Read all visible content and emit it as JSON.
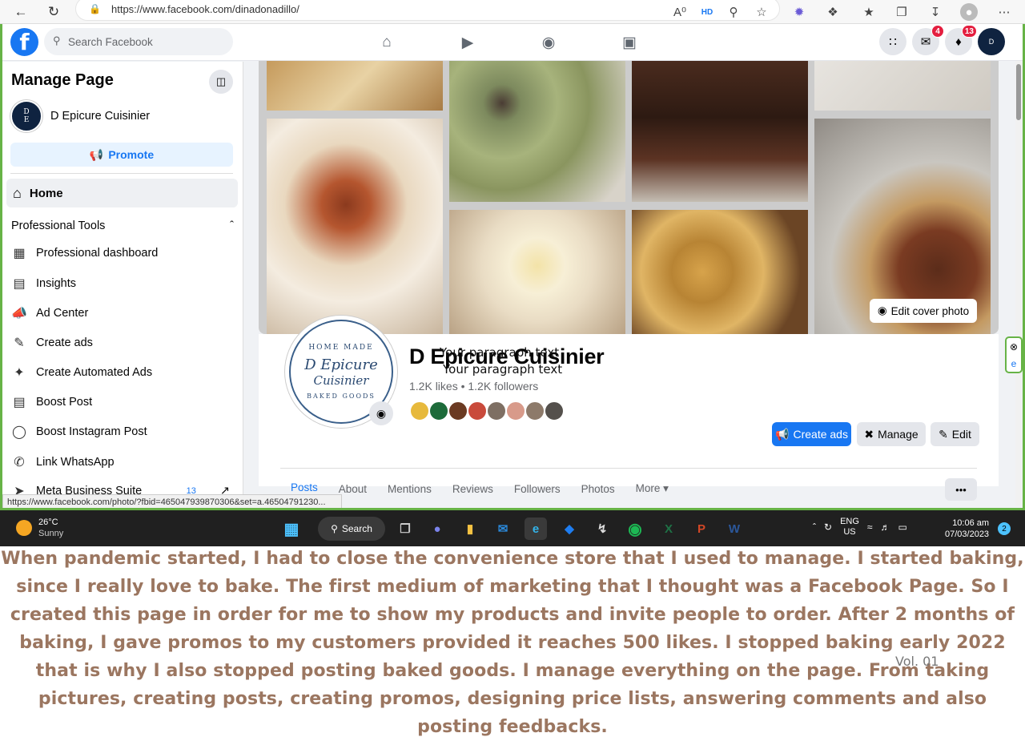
{
  "browser": {
    "url": "https://www.facebook.com/dinadonadillo/",
    "icons": [
      "back-arrow-icon",
      "refresh-icon",
      "lock-icon",
      "read-aloud-icon",
      "hd-icon",
      "zoom-icon",
      "favorite-add-icon",
      "copilot-icon",
      "extensions-icon",
      "favorites-icon",
      "collections-icon",
      "downloads-icon",
      "profile-icon",
      "more-icon"
    ]
  },
  "fb": {
    "search_placeholder": "Search Facebook",
    "messenger_badge": "4",
    "notif_badge": "13"
  },
  "sidebar": {
    "title": "Manage Page",
    "page_name": "D Epicure Cuisinier",
    "promote": "Promote",
    "home": "Home",
    "section": "Professional Tools",
    "items": [
      {
        "label": "Professional dashboard",
        "icon": "dashboard-icon"
      },
      {
        "label": "Insights",
        "icon": "insights-icon"
      },
      {
        "label": "Ad Center",
        "icon": "megaphone-icon"
      },
      {
        "label": "Create ads",
        "icon": "pencil-icon"
      },
      {
        "label": "Create Automated Ads",
        "icon": "magic-wand-icon"
      },
      {
        "label": "Boost Post",
        "icon": "boost-icon"
      },
      {
        "label": "Boost Instagram Post",
        "icon": "instagram-icon"
      },
      {
        "label": "Link WhatsApp",
        "icon": "whatsapp-icon"
      },
      {
        "label": "Meta Business Suite",
        "icon": "meta-icon",
        "count": "13"
      }
    ]
  },
  "profile": {
    "edit_cover": "Edit cover photo",
    "name": "D Epicure Cuisinier",
    "stats": "1.2K likes • 1.2K followers",
    "overlay1": "Your paragraph text",
    "overlay2": "Your paragraph text",
    "avatar_text": {
      "top": "HOME MADE",
      "mid1": "D Epicure",
      "mid2": "Cuisinier",
      "bottom": "BAKED GOODS"
    },
    "create_ads": "Create ads",
    "manage": "Manage",
    "edit": "Edit",
    "tabs": [
      "Posts",
      "About",
      "Mentions",
      "Reviews",
      "Followers",
      "Photos",
      "More ▾"
    ],
    "more": "•••"
  },
  "statusbar_url": "https://www.facebook.com/photo/?fbid=465047939870306&set=a.46504791230...",
  "taskbar": {
    "temp": "26°C",
    "weather": "Sunny",
    "search": "Search",
    "lang1": "ENG",
    "lang2": "US",
    "time": "10:06 am",
    "date": "07/03/2023",
    "notif": "2"
  },
  "caption": "When pandemic started, I had to close the convenience store that I used to manage. I started baking, since I really love to bake. The first medium of marketing that I thought was a Facebook Page. So I created this page in order for me to show my products and invite people to order. After 2 months of baking, I gave promos to my customers provided it reaches 500 likes. I stopped baking early 2022 that is why I also stopped posting baked goods.  I manage everything on the page. From taking pictures, creating posts, creating promos, designing price lists, answering comments and also posting feedbacks.",
  "vol": "Vol. 01"
}
